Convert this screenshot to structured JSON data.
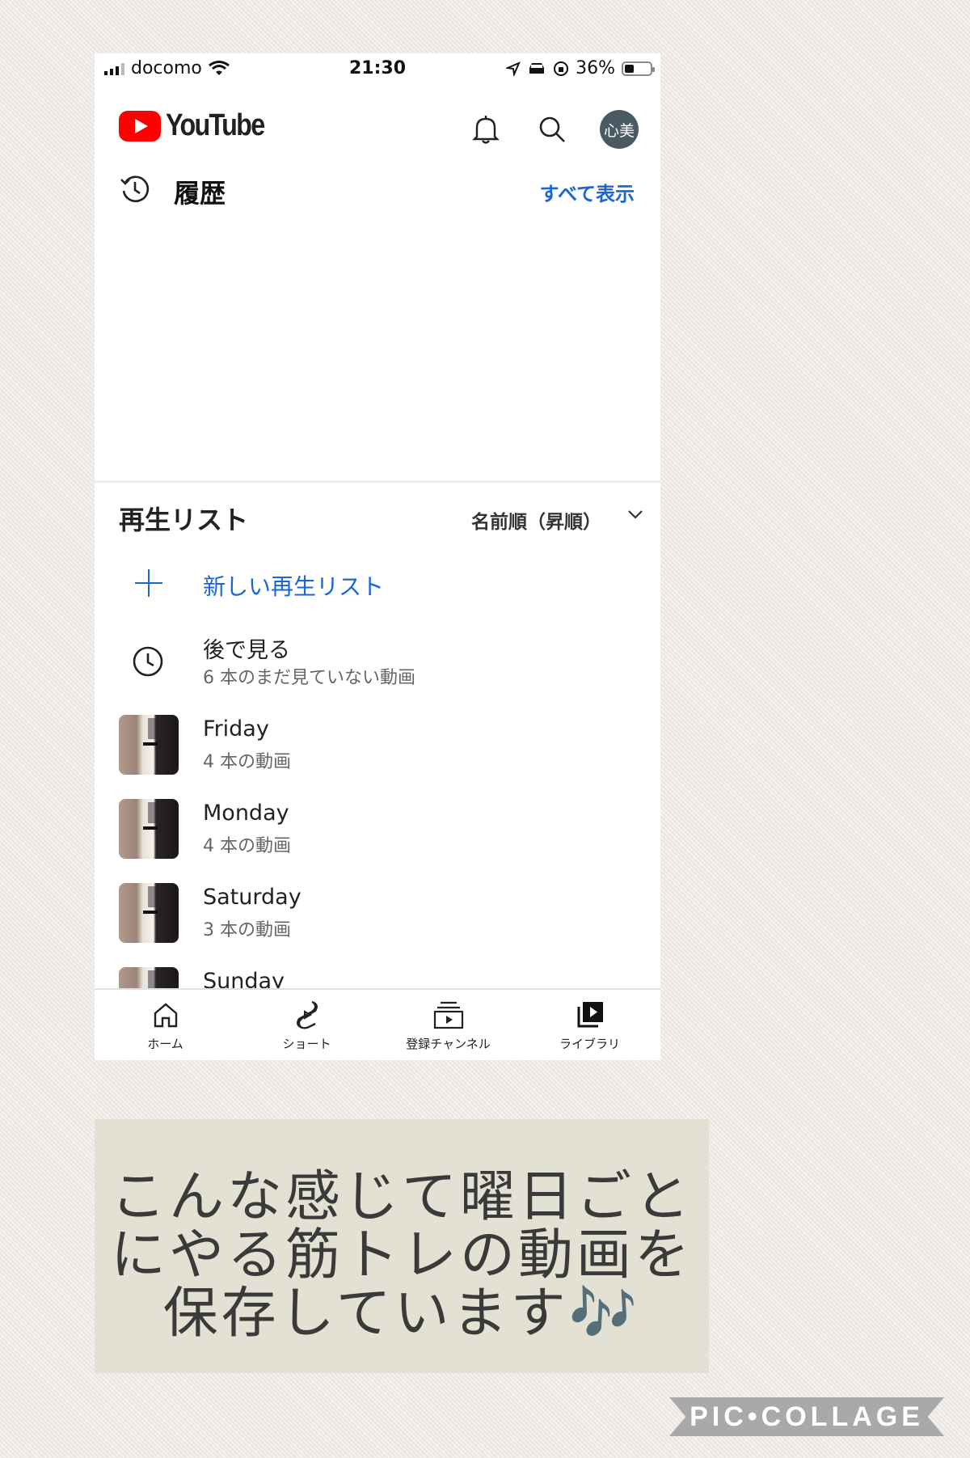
{
  "status_bar": {
    "carrier": "docomo",
    "time": "21:30",
    "battery": "36%",
    "battery_level": 0.36
  },
  "header": {
    "logo_text": "YouTube",
    "avatar_text": "心美"
  },
  "history": {
    "title": "履歴",
    "show_all": "すべて表示"
  },
  "playlists": {
    "title": "再生リスト",
    "sort_label": "名前順（昇順）",
    "new_playlist": "新しい再生リスト",
    "items": [
      {
        "name": "後で見る",
        "count": "6 本のまだ見ていない動画"
      },
      {
        "name": "Friday",
        "count": "4 本の動画"
      },
      {
        "name": "Monday",
        "count": "4 本の動画"
      },
      {
        "name": "Saturday",
        "count": "3 本の動画"
      },
      {
        "name": "Sunday",
        "count": ""
      }
    ]
  },
  "nav": {
    "items": [
      {
        "label": "ホーム",
        "icon": "home-icon"
      },
      {
        "label": "ショート",
        "icon": "shorts-icon"
      },
      {
        "label": "登録チャンネル",
        "icon": "subscriptions-icon"
      },
      {
        "label": "ライブラリ",
        "icon": "library-icon"
      }
    ]
  },
  "caption": {
    "line1": "こんな感じて曜日ごと",
    "line2": "にやる筋トレの動画を",
    "line3": "保存しています🎶"
  },
  "watermark": "PIC•COLLAGE"
}
